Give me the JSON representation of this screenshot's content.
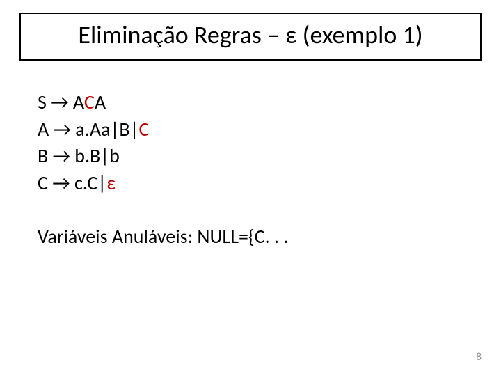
{
  "title": "Eliminação Regras – ε (exemplo 1)",
  "rules": {
    "S": {
      "lhs": "S",
      "arrow": "→",
      "pre": " A",
      "mid": "C",
      "post": "A"
    },
    "A": {
      "lhs": "A",
      "arrow": "→",
      "pre": " a.Aa|B|",
      "mid": "C",
      "post": ""
    },
    "B": {
      "lhs": "B",
      "arrow": "→",
      "pre": " b.B|b",
      "mid": "",
      "post": ""
    },
    "C": {
      "lhs": "C",
      "arrow": "→",
      "pre": " c.C|",
      "mid": "ε",
      "post": ""
    }
  },
  "nullables_line": "Variáveis Anuláveis: NULL={C. . .",
  "page_number": "8"
}
